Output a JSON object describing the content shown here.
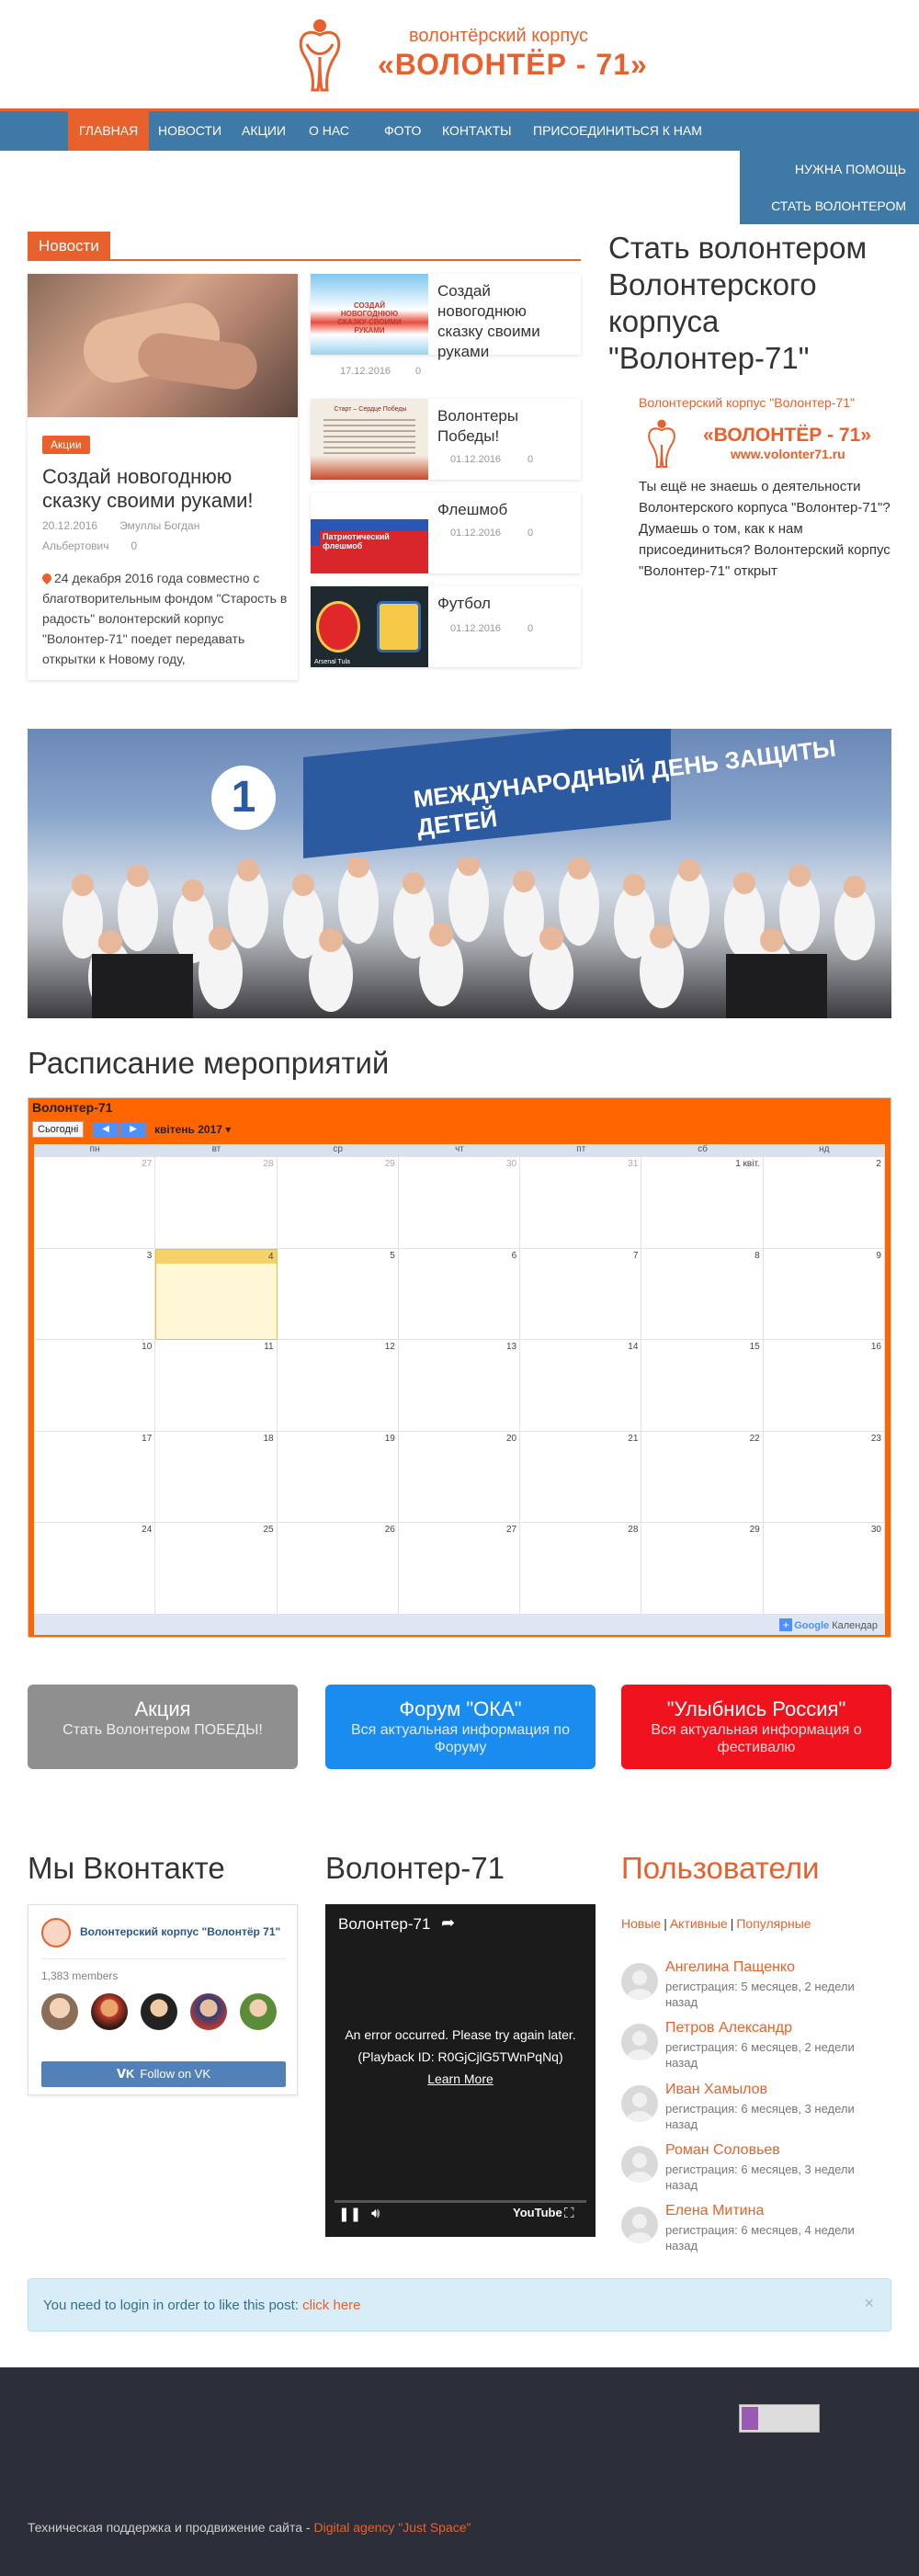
{
  "header": {
    "logo_small": "волонтёрский корпус",
    "logo_big": "«ВОЛОНТЁР - 71»"
  },
  "nav": {
    "items": [
      {
        "label": "ГЛАВНАЯ"
      },
      {
        "label": "НОВОСТИ"
      },
      {
        "label": "АКЦИИ"
      },
      {
        "label": "О НАС"
      },
      {
        "label": "ФОТО"
      },
      {
        "label": "КОНТАКТЫ"
      },
      {
        "label": "ПРИСОЕДИНИТЬСЯ К НАМ"
      }
    ],
    "dropdown": [
      "НУЖНА ПОМОЩЬ",
      "СТАТЬ ВОЛОНТЕРОМ"
    ]
  },
  "news": {
    "tab_label": "Новости",
    "feature": {
      "tag": "Акции",
      "title": "Создай новогоднюю сказку своими руками!",
      "date": "20.12.2016",
      "author": "Эмуллы Богдан Альбертович",
      "comments": "0",
      "text": "24 декабря 2016 года совместно с благотворительным фондом \"Старость в радость\" волонтерский корпус \"Волонтер-71\" поедет передавать открытки к Новому году,"
    },
    "items": [
      {
        "title": "Создай новогоднюю сказку своими руками",
        "date": "17.12.2016",
        "comments": "0",
        "thumb_text": "СОЗДАЙ НОВОГОДНЮЮ СКАЗКУ СВОИМИ РУКАМИ"
      },
      {
        "title": "Волонтеры Победы!",
        "date": "01.12.2016",
        "comments": "0",
        "thumb_text": "Старт – Сердце Победы"
      },
      {
        "title": "Флешмоб",
        "date": "01.12.2016",
        "comments": "0",
        "thumb_text": "Патриотический флешмоб"
      },
      {
        "title": "Футбол",
        "date": "01.12.2016",
        "comments": "0",
        "thumb_text": "Arsenal Tula"
      }
    ]
  },
  "sidebar": {
    "title": "Стать волонтером Волонтерского корпуса \"Волонтер-71\"",
    "brand": "Волонтерский корпус \"Волонтер-71\"",
    "logo_big": "«ВОЛОНТЁР - 71»",
    "logo_url": "www.volonter71.ru",
    "text": "Ты ещё не знаешь о деятельности Волонтерского корпуса \"Волонтер-71\"? Думаешь о том,  как  к нам присоединиться? Волонтерский корпус \"Волонтер-71\" открыт"
  },
  "banner": {
    "sign": "МЕЖДУНАРОДНЫЙ ДЕНЬ ЗАЩИТЫ ДЕТЕЙ",
    "channel": "1"
  },
  "schedule": {
    "title": "Расписание мероприятий",
    "calendar_name": "Волонтер-71",
    "today_button": "Сьогодні",
    "month": "квітень 2017",
    "weekdays": [
      "пн",
      "вт",
      "ср",
      "чт",
      "пт",
      "сб",
      "нд"
    ],
    "weeks": [
      [
        "27",
        "28",
        "29",
        "30",
        "31",
        "1 квіт.",
        "2"
      ],
      [
        "3",
        "4",
        "5",
        "6",
        "7",
        "8",
        "9"
      ],
      [
        "10",
        "11",
        "12",
        "13",
        "14",
        "15",
        "16"
      ],
      [
        "17",
        "18",
        "19",
        "20",
        "21",
        "22",
        "23"
      ],
      [
        "24",
        "25",
        "26",
        "27",
        "28",
        "29",
        "30"
      ]
    ],
    "footer_label": "Календар",
    "footer_brand": "Google"
  },
  "actions": [
    {
      "title": "Акция",
      "sub": "Стать Волонтером ПОБЕДЫ!",
      "color": "#8f8f8f"
    },
    {
      "title": "Форум \"ОКА\"",
      "sub": "Вся актуальная информация по Форуму",
      "color": "#1a8cf0"
    },
    {
      "title": "\"Улыбнись Россия\"",
      "sub": "Вся актуальная информация о фестивалю",
      "color": "#f0121c"
    }
  ],
  "vk": {
    "section_title": "Мы Вконтакте",
    "group_name": "Волонтерский корпус \"Волонтёр 71\"",
    "members": "1,383 members",
    "follow": "Follow on VK"
  },
  "video": {
    "section_title": "Волонтер-71",
    "title": "Волонтер-71",
    "error": "An error occurred. Please try again later. (Playback ID: R0GjCjlG5TWnPqNq)",
    "learn_more": "Learn More",
    "brand": "YouTube"
  },
  "users": {
    "section_title": "Пользователи",
    "tabs": [
      "Новые",
      "Активные",
      "Популярные"
    ],
    "list": [
      {
        "name": "Ангелина Пащенко",
        "reg": "регистрация: 5 месяцев, 2 недели назад"
      },
      {
        "name": "Петров Александр",
        "reg": "регистрация: 6 месяцев, 2 недели назад"
      },
      {
        "name": "Иван Хамылов",
        "reg": "регистрация: 6 месяцев, 3 недели назад"
      },
      {
        "name": "Роман Соловьев",
        "reg": "регистрация: 6 месяцев, 3 недели назад"
      },
      {
        "name": "Елена Митина",
        "reg": "регистрация: 6 месяцев, 4 недели назад"
      }
    ]
  },
  "login_bar": {
    "text": "You need to login in order to like this post:",
    "link": "click here",
    "close": "×"
  },
  "footer": {
    "text": "Техническая поддержка и продвижение сайта -",
    "link": "Digital agency \"Just Space\""
  },
  "colors": {
    "accent": "#e8612c",
    "nav": "#3f79a7",
    "calendar": "#ff6600",
    "footer": "#2c2f3a"
  }
}
